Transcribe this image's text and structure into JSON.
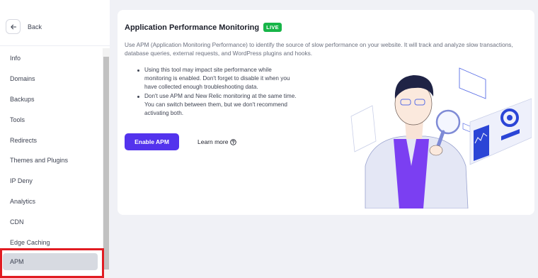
{
  "sidebar": {
    "back_label": "Back",
    "items": [
      {
        "label": "Info"
      },
      {
        "label": "Domains"
      },
      {
        "label": "Backups"
      },
      {
        "label": "Tools"
      },
      {
        "label": "Redirects"
      },
      {
        "label": "Themes and Plugins"
      },
      {
        "label": "IP Deny"
      },
      {
        "label": "Analytics"
      },
      {
        "label": "CDN"
      },
      {
        "label": "Edge Caching"
      },
      {
        "label": "APM",
        "active": true
      }
    ]
  },
  "card": {
    "title": "Application Performance Monitoring",
    "badge": "LIVE",
    "description": "Use APM (Application Monitoring Performance) to identify the source of slow performance on your website. It will track and analyze slow transactions, database queries, external requests, and WordPress plugins and hooks.",
    "bullets": [
      "Using this tool may impact site performance while monitoring is enabled. Don't forget to disable it when you have collected enough troubleshooting data.",
      "Don't use APM and New Relic monitoring at the same time. You can switch between them, but we don't recommend activating both."
    ],
    "enable_label": "Enable APM",
    "learn_more_label": "Learn more"
  },
  "colors": {
    "accent": "#5333ed",
    "live_badge": "#17b548",
    "highlight": "#e11c22",
    "active_item_bg": "#d7dae1"
  },
  "icons": {
    "back": "arrow-left-icon",
    "learn_more": "question-circle-icon"
  }
}
